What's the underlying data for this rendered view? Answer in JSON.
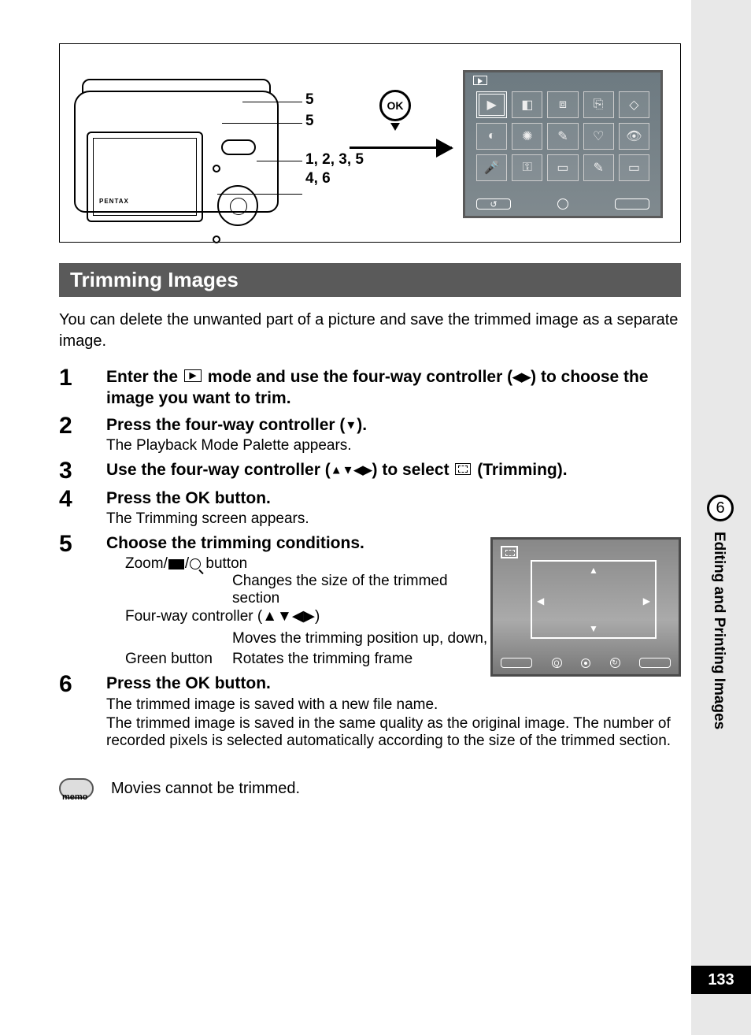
{
  "diagram": {
    "camera_brand": "PENTAX",
    "ok_label": "OK",
    "callouts": [
      "5",
      "5",
      "1, 2, 3, 5",
      "4, 6"
    ]
  },
  "section_title": "Trimming Images",
  "intro": "You can delete the unwanted part of a picture and save the trimmed image as a separate image.",
  "steps": [
    {
      "num": "1",
      "title_parts": [
        "Enter the ",
        " mode and use the four-way controller (",
        "◀",
        "▶",
        ") to choose the image you want to trim."
      ]
    },
    {
      "num": "2",
      "title_parts": [
        "Press the four-way controller (",
        "▼",
        ")."
      ],
      "sub": "The Playback Mode Palette appears."
    },
    {
      "num": "3",
      "title_parts": [
        "Use the four-way controller (",
        "▲",
        "▼",
        "◀",
        "▶",
        ") to select ",
        " (Trimming)."
      ]
    },
    {
      "num": "4",
      "title_parts": [
        "Press the ",
        "OK",
        " button."
      ],
      "sub": "The Trimming screen appears."
    },
    {
      "num": "5",
      "title": "Choose the trimming conditions.",
      "controls": [
        {
          "label_pre": "Zoom/",
          "label_post": " button",
          "desc": "Changes the size of the trimmed section"
        },
        {
          "label": "Four-way controller (▲▼◀▶)",
          "desc": "Moves the trimming position up, down, left and right"
        },
        {
          "label": "Green button",
          "desc": "Rotates the trimming frame"
        }
      ]
    },
    {
      "num": "6",
      "title_parts": [
        "Press the ",
        "OK",
        " button."
      ],
      "sub_lines": [
        "The trimmed image is saved with a new file name.",
        "The trimmed image is saved in the same quality as the original image. The number of recorded pixels is selected automatically according to the size of the trimmed section."
      ]
    }
  ],
  "memo": {
    "icon_label": "memo",
    "text": "Movies cannot be trimmed."
  },
  "sidebar": {
    "chapter_number": "6",
    "chapter_title": "Editing and Printing Images",
    "page_number": "133"
  }
}
